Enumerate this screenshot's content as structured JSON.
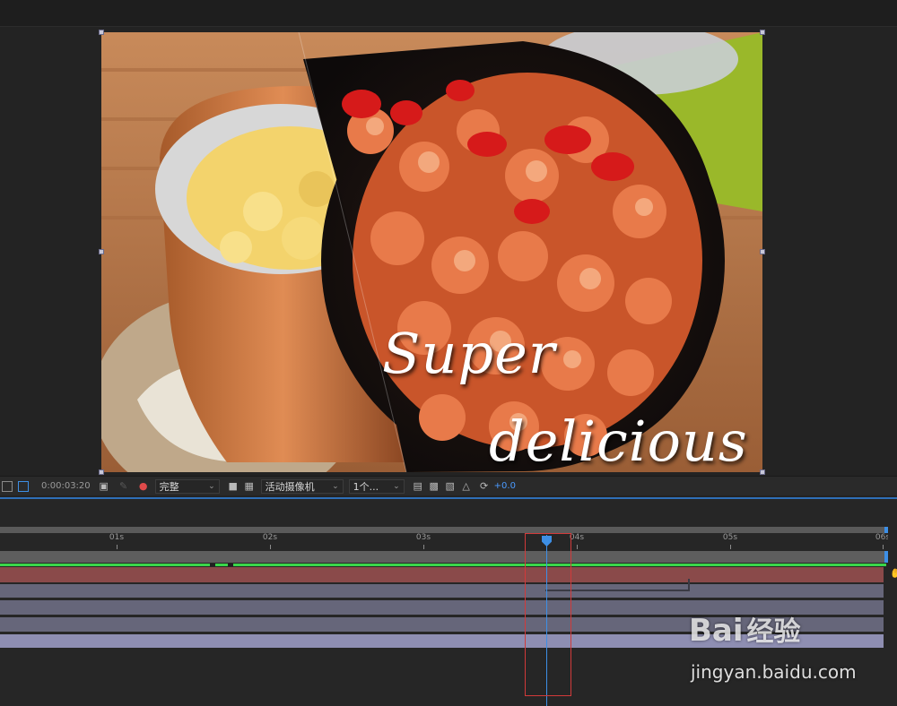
{
  "composition": {
    "overlay_line1": "Super",
    "overlay_line2": "delicious"
  },
  "viewer_toolbar": {
    "timecode": "0:00:03:20",
    "resolution": "完整",
    "camera": "活动摄像机",
    "views": "1个...",
    "exposure": "+0.0",
    "icons": [
      "region-icon",
      "transparency-grid-icon",
      "camera-snapshot-icon",
      "show-snapshot-icon",
      "color-channel-icon",
      "mask-toggle-icon",
      "grid-icon",
      "3d-view-icon",
      "fast-preview-icon",
      "flowchart-icon",
      "reset-exposure-icon"
    ]
  },
  "timeline": {
    "ruler_ticks": [
      "01s",
      "02s",
      "03s",
      "04s",
      "05s",
      "06s"
    ],
    "current_time_label": "04s"
  },
  "watermark": {
    "logo": "Bai",
    "logo_suffix": "经验",
    "url": "jingyan.baidu.com"
  },
  "colors": {
    "accent_blue": "#3d8fe6",
    "work_area_green": "#3ad64a",
    "highlight_red": "#d23a3a"
  }
}
